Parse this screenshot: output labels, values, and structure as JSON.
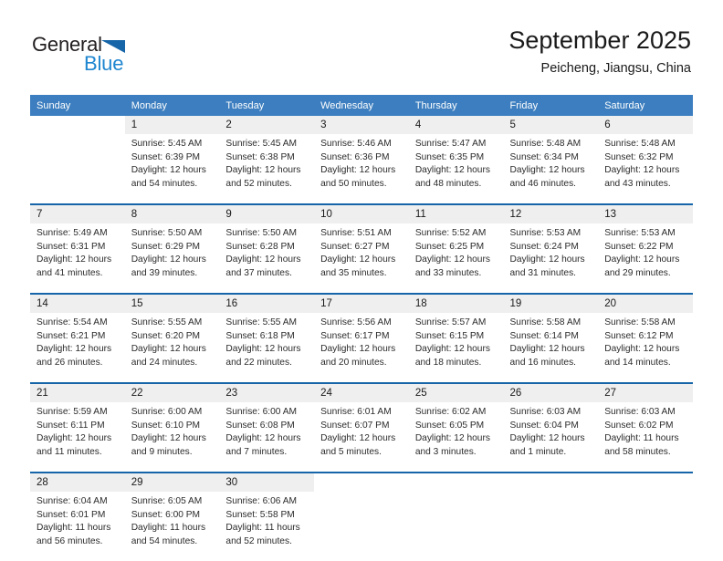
{
  "brand": {
    "name_part1": "General",
    "name_part2": "Blue",
    "accent_color": "#1f86d0",
    "triangle_color": "#1565a8"
  },
  "header": {
    "title": "September 2025",
    "subtitle": "Peicheng, Jiangsu, China",
    "header_bg": "#3c7ebf",
    "separator_color": "#1565a8",
    "daynum_bg": "#efefef"
  },
  "weekday_headers": [
    "Sunday",
    "Monday",
    "Tuesday",
    "Wednesday",
    "Thursday",
    "Friday",
    "Saturday"
  ],
  "weeks": [
    {
      "days": [
        {
          "num": "",
          "sunrise": "",
          "sunset": "",
          "daylight_line1": "",
          "daylight_line2": "",
          "empty": true
        },
        {
          "num": "1",
          "sunrise": "Sunrise: 5:45 AM",
          "sunset": "Sunset: 6:39 PM",
          "daylight_line1": "Daylight: 12 hours",
          "daylight_line2": "and 54 minutes.",
          "empty": false
        },
        {
          "num": "2",
          "sunrise": "Sunrise: 5:45 AM",
          "sunset": "Sunset: 6:38 PM",
          "daylight_line1": "Daylight: 12 hours",
          "daylight_line2": "and 52 minutes.",
          "empty": false
        },
        {
          "num": "3",
          "sunrise": "Sunrise: 5:46 AM",
          "sunset": "Sunset: 6:36 PM",
          "daylight_line1": "Daylight: 12 hours",
          "daylight_line2": "and 50 minutes.",
          "empty": false
        },
        {
          "num": "4",
          "sunrise": "Sunrise: 5:47 AM",
          "sunset": "Sunset: 6:35 PM",
          "daylight_line1": "Daylight: 12 hours",
          "daylight_line2": "and 48 minutes.",
          "empty": false
        },
        {
          "num": "5",
          "sunrise": "Sunrise: 5:48 AM",
          "sunset": "Sunset: 6:34 PM",
          "daylight_line1": "Daylight: 12 hours",
          "daylight_line2": "and 46 minutes.",
          "empty": false
        },
        {
          "num": "6",
          "sunrise": "Sunrise: 5:48 AM",
          "sunset": "Sunset: 6:32 PM",
          "daylight_line1": "Daylight: 12 hours",
          "daylight_line2": "and 43 minutes.",
          "empty": false
        }
      ]
    },
    {
      "days": [
        {
          "num": "7",
          "sunrise": "Sunrise: 5:49 AM",
          "sunset": "Sunset: 6:31 PM",
          "daylight_line1": "Daylight: 12 hours",
          "daylight_line2": "and 41 minutes.",
          "empty": false
        },
        {
          "num": "8",
          "sunrise": "Sunrise: 5:50 AM",
          "sunset": "Sunset: 6:29 PM",
          "daylight_line1": "Daylight: 12 hours",
          "daylight_line2": "and 39 minutes.",
          "empty": false
        },
        {
          "num": "9",
          "sunrise": "Sunrise: 5:50 AM",
          "sunset": "Sunset: 6:28 PM",
          "daylight_line1": "Daylight: 12 hours",
          "daylight_line2": "and 37 minutes.",
          "empty": false
        },
        {
          "num": "10",
          "sunrise": "Sunrise: 5:51 AM",
          "sunset": "Sunset: 6:27 PM",
          "daylight_line1": "Daylight: 12 hours",
          "daylight_line2": "and 35 minutes.",
          "empty": false
        },
        {
          "num": "11",
          "sunrise": "Sunrise: 5:52 AM",
          "sunset": "Sunset: 6:25 PM",
          "daylight_line1": "Daylight: 12 hours",
          "daylight_line2": "and 33 minutes.",
          "empty": false
        },
        {
          "num": "12",
          "sunrise": "Sunrise: 5:53 AM",
          "sunset": "Sunset: 6:24 PM",
          "daylight_line1": "Daylight: 12 hours",
          "daylight_line2": "and 31 minutes.",
          "empty": false
        },
        {
          "num": "13",
          "sunrise": "Sunrise: 5:53 AM",
          "sunset": "Sunset: 6:22 PM",
          "daylight_line1": "Daylight: 12 hours",
          "daylight_line2": "and 29 minutes.",
          "empty": false
        }
      ]
    },
    {
      "days": [
        {
          "num": "14",
          "sunrise": "Sunrise: 5:54 AM",
          "sunset": "Sunset: 6:21 PM",
          "daylight_line1": "Daylight: 12 hours",
          "daylight_line2": "and 26 minutes.",
          "empty": false
        },
        {
          "num": "15",
          "sunrise": "Sunrise: 5:55 AM",
          "sunset": "Sunset: 6:20 PM",
          "daylight_line1": "Daylight: 12 hours",
          "daylight_line2": "and 24 minutes.",
          "empty": false
        },
        {
          "num": "16",
          "sunrise": "Sunrise: 5:55 AM",
          "sunset": "Sunset: 6:18 PM",
          "daylight_line1": "Daylight: 12 hours",
          "daylight_line2": "and 22 minutes.",
          "empty": false
        },
        {
          "num": "17",
          "sunrise": "Sunrise: 5:56 AM",
          "sunset": "Sunset: 6:17 PM",
          "daylight_line1": "Daylight: 12 hours",
          "daylight_line2": "and 20 minutes.",
          "empty": false
        },
        {
          "num": "18",
          "sunrise": "Sunrise: 5:57 AM",
          "sunset": "Sunset: 6:15 PM",
          "daylight_line1": "Daylight: 12 hours",
          "daylight_line2": "and 18 minutes.",
          "empty": false
        },
        {
          "num": "19",
          "sunrise": "Sunrise: 5:58 AM",
          "sunset": "Sunset: 6:14 PM",
          "daylight_line1": "Daylight: 12 hours",
          "daylight_line2": "and 16 minutes.",
          "empty": false
        },
        {
          "num": "20",
          "sunrise": "Sunrise: 5:58 AM",
          "sunset": "Sunset: 6:12 PM",
          "daylight_line1": "Daylight: 12 hours",
          "daylight_line2": "and 14 minutes.",
          "empty": false
        }
      ]
    },
    {
      "days": [
        {
          "num": "21",
          "sunrise": "Sunrise: 5:59 AM",
          "sunset": "Sunset: 6:11 PM",
          "daylight_line1": "Daylight: 12 hours",
          "daylight_line2": "and 11 minutes.",
          "empty": false
        },
        {
          "num": "22",
          "sunrise": "Sunrise: 6:00 AM",
          "sunset": "Sunset: 6:10 PM",
          "daylight_line1": "Daylight: 12 hours",
          "daylight_line2": "and 9 minutes.",
          "empty": false
        },
        {
          "num": "23",
          "sunrise": "Sunrise: 6:00 AM",
          "sunset": "Sunset: 6:08 PM",
          "daylight_line1": "Daylight: 12 hours",
          "daylight_line2": "and 7 minutes.",
          "empty": false
        },
        {
          "num": "24",
          "sunrise": "Sunrise: 6:01 AM",
          "sunset": "Sunset: 6:07 PM",
          "daylight_line1": "Daylight: 12 hours",
          "daylight_line2": "and 5 minutes.",
          "empty": false
        },
        {
          "num": "25",
          "sunrise": "Sunrise: 6:02 AM",
          "sunset": "Sunset: 6:05 PM",
          "daylight_line1": "Daylight: 12 hours",
          "daylight_line2": "and 3 minutes.",
          "empty": false
        },
        {
          "num": "26",
          "sunrise": "Sunrise: 6:03 AM",
          "sunset": "Sunset: 6:04 PM",
          "daylight_line1": "Daylight: 12 hours",
          "daylight_line2": "and 1 minute.",
          "empty": false
        },
        {
          "num": "27",
          "sunrise": "Sunrise: 6:03 AM",
          "sunset": "Sunset: 6:02 PM",
          "daylight_line1": "Daylight: 11 hours",
          "daylight_line2": "and 58 minutes.",
          "empty": false
        }
      ]
    },
    {
      "days": [
        {
          "num": "28",
          "sunrise": "Sunrise: 6:04 AM",
          "sunset": "Sunset: 6:01 PM",
          "daylight_line1": "Daylight: 11 hours",
          "daylight_line2": "and 56 minutes.",
          "empty": false
        },
        {
          "num": "29",
          "sunrise": "Sunrise: 6:05 AM",
          "sunset": "Sunset: 6:00 PM",
          "daylight_line1": "Daylight: 11 hours",
          "daylight_line2": "and 54 minutes.",
          "empty": false
        },
        {
          "num": "30",
          "sunrise": "Sunrise: 6:06 AM",
          "sunset": "Sunset: 5:58 PM",
          "daylight_line1": "Daylight: 11 hours",
          "daylight_line2": "and 52 minutes.",
          "empty": false
        },
        {
          "num": "",
          "sunrise": "",
          "sunset": "",
          "daylight_line1": "",
          "daylight_line2": "",
          "empty": true
        },
        {
          "num": "",
          "sunrise": "",
          "sunset": "",
          "daylight_line1": "",
          "daylight_line2": "",
          "empty": true
        },
        {
          "num": "",
          "sunrise": "",
          "sunset": "",
          "daylight_line1": "",
          "daylight_line2": "",
          "empty": true
        },
        {
          "num": "",
          "sunrise": "",
          "sunset": "",
          "daylight_line1": "",
          "daylight_line2": "",
          "empty": true
        }
      ]
    }
  ]
}
